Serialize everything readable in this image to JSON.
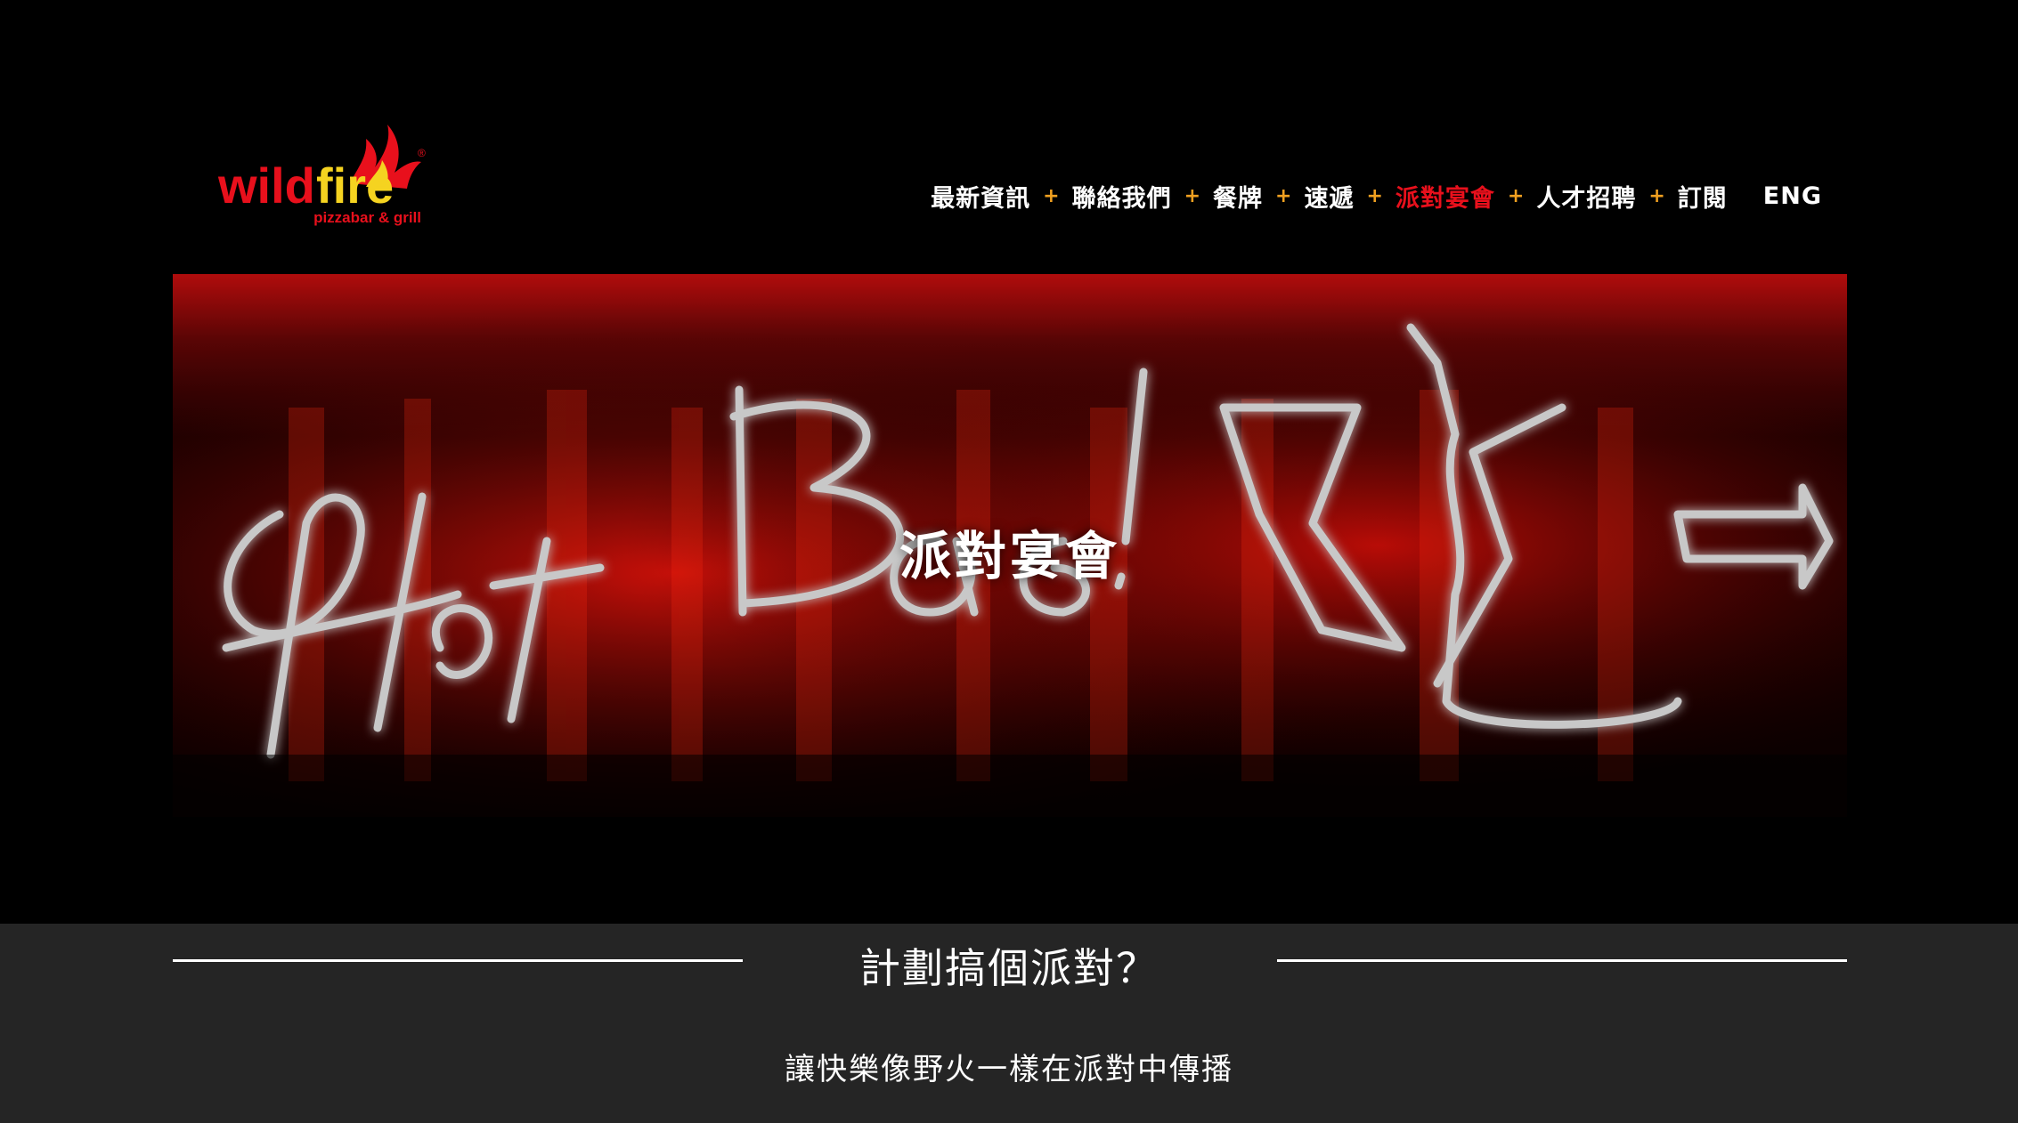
{
  "brand": {
    "name_part1": "wild",
    "name_part2": "fire",
    "tagline": "pizzabar & grill",
    "registered": "®",
    "colors": {
      "red": "#e8101c",
      "yellow": "#f5d320"
    }
  },
  "nav": {
    "items": [
      {
        "label": "最新資訊",
        "active": false
      },
      {
        "label": "聯絡我們",
        "active": false
      },
      {
        "label": "餐牌",
        "active": false
      },
      {
        "label": "速遞",
        "active": false
      },
      {
        "label": "派對宴會",
        "active": true
      },
      {
        "label": "人才招聘",
        "active": false
      },
      {
        "label": "訂閱",
        "active": false
      }
    ],
    "separator": "+",
    "language": "ENG",
    "active_color": "#e8101c",
    "separator_color": "#f0a020"
  },
  "hero": {
    "title": "派對宴會",
    "image_icon": "neon-sign-image"
  },
  "section": {
    "title": "計劃搞個派對？",
    "subtitle": "讓快樂像野火一樣在派對中傳播",
    "background": "#252525"
  }
}
